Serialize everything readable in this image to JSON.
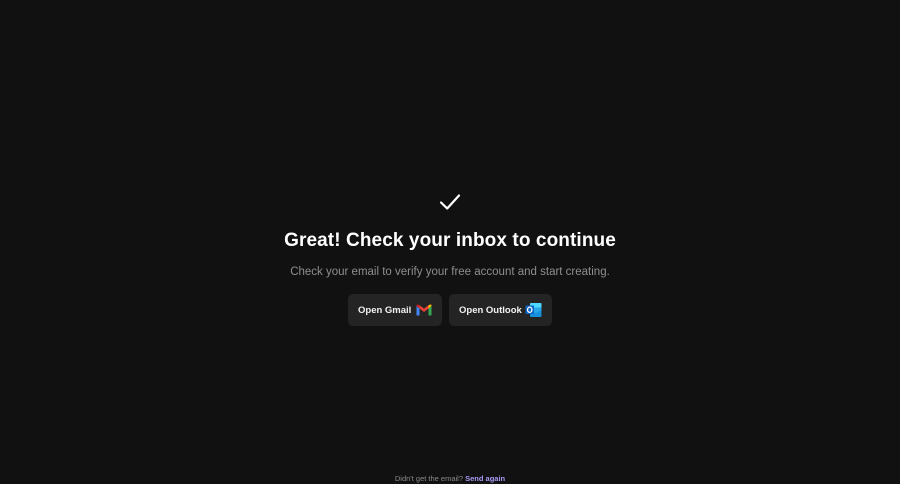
{
  "hero": {
    "icon": "check-icon",
    "title": "Great! Check your inbox to continue",
    "subtitle": "Check your email to verify your free account and start creating."
  },
  "actions": {
    "gmail_label": "Open Gmail",
    "gmail_icon": "gmail-icon",
    "outlook_label": "Open Outlook",
    "outlook_icon": "outlook-icon"
  },
  "footer": {
    "prompt": "Didn't get the email?",
    "link": "Send again"
  },
  "colors": {
    "background": "#111111",
    "button_bg": "#242424",
    "link": "#a99bf5",
    "muted_text": "#8e8e8e"
  }
}
